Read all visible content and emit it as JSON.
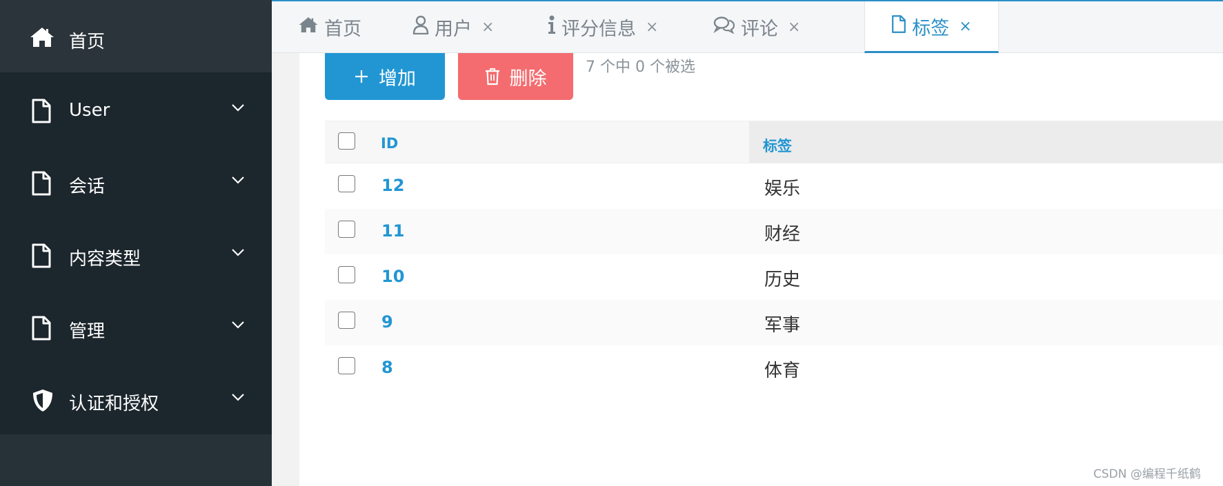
{
  "sidebar": {
    "home": {
      "label": "首页",
      "icon": "home-icon"
    },
    "items": [
      {
        "label": "User",
        "icon": "file-icon"
      },
      {
        "label": "会话",
        "icon": "file-icon"
      },
      {
        "label": "内容类型",
        "icon": "file-icon"
      },
      {
        "label": "管理",
        "icon": "file-icon"
      },
      {
        "label": "认证和授权",
        "icon": "shield-icon"
      }
    ]
  },
  "tabs": [
    {
      "label": "首页",
      "icon": "home-icon",
      "closable": false
    },
    {
      "label": "用户",
      "icon": "user-icon",
      "closable": true,
      "close": "×"
    },
    {
      "label": "评分信息",
      "icon": "info-icon",
      "closable": true,
      "close": "×"
    },
    {
      "label": "评论",
      "icon": "comments-icon",
      "closable": true,
      "close": "×"
    },
    {
      "label": "标签",
      "icon": "file-icon",
      "closable": true,
      "close": "×",
      "active": true
    }
  ],
  "toolbar": {
    "add_label": "增加",
    "delete_label": "删除",
    "selection_count": "7 个中 0 个被选"
  },
  "table": {
    "columns": [
      "ID",
      "标签"
    ],
    "rows": [
      {
        "id": "12",
        "tag": "娱乐"
      },
      {
        "id": "11",
        "tag": "财经"
      },
      {
        "id": "10",
        "tag": "历史"
      },
      {
        "id": "9",
        "tag": "军事"
      },
      {
        "id": "8",
        "tag": "体育"
      }
    ]
  },
  "watermark": "CSDN @编程千纸鹤",
  "colors": {
    "accent": "#2196d3",
    "danger": "#f46c6f",
    "sidebar": "#1c262d"
  }
}
